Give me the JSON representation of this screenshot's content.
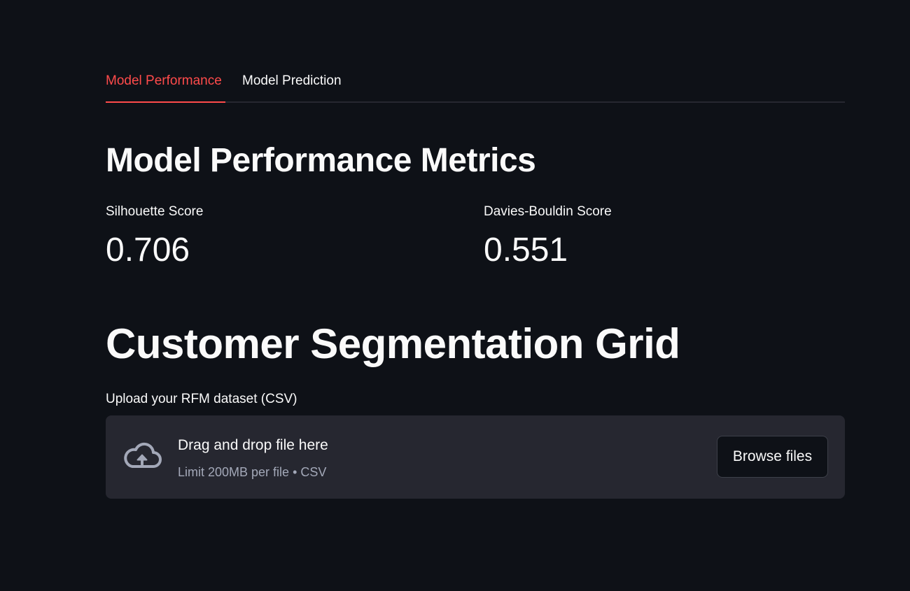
{
  "tabs": [
    {
      "label": "Model Performance",
      "active": true
    },
    {
      "label": "Model Prediction",
      "active": false
    }
  ],
  "colors": {
    "background": "#0e1117",
    "accent": "#ff4b4b",
    "surface": "#262730",
    "text": "#fafafa",
    "muted_text": "#a3a8b8"
  },
  "metrics_section": {
    "heading": "Model Performance Metrics",
    "metrics": [
      {
        "label": "Silhouette Score",
        "value": "0.706"
      },
      {
        "label": "Davies-Bouldin Score",
        "value": "0.551"
      }
    ]
  },
  "grid_section": {
    "heading": "Customer Segmentation Grid",
    "uploader": {
      "label": "Upload your RFM dataset (CSV)",
      "icon": "cloud-upload-icon",
      "title": "Drag and drop file here",
      "subtitle": "Limit 200MB per file • CSV",
      "button_label": "Browse files"
    }
  }
}
